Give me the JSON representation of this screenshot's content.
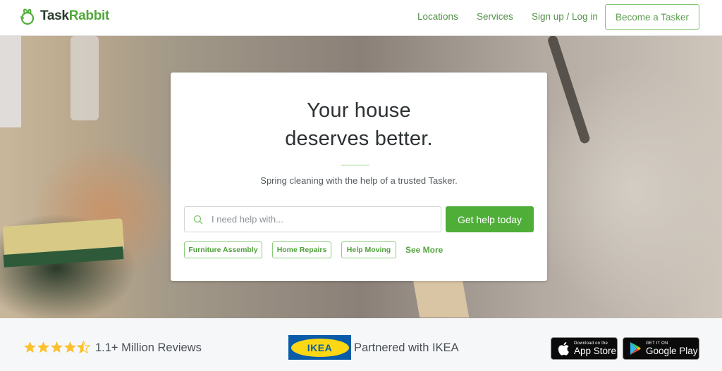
{
  "header": {
    "logo": {
      "part1": "Task",
      "part2": "Rabbit",
      "icon": "rabbit-logo-icon"
    },
    "nav": [
      {
        "label": "Locations"
      },
      {
        "label": "Services"
      },
      {
        "label": "Sign up / Log in"
      }
    ],
    "cta_label": "Become a Tasker"
  },
  "hero": {
    "headline_line1": "Your house",
    "headline_line2": "deserves better.",
    "subline": "Spring cleaning with the help of a trusted Tasker.",
    "search": {
      "placeholder": "I need help with...",
      "value": "",
      "icon": "search-icon"
    },
    "submit_label": "Get help today",
    "chips": [
      {
        "label": "Furniture Assembly"
      },
      {
        "label": "Home Repairs"
      },
      {
        "label": "Help Moving"
      }
    ],
    "see_more": "See More"
  },
  "footer": {
    "rating": {
      "value": 4.5,
      "max": 5
    },
    "reviews": "1.1+ Million Reviews",
    "ikea_logo": "IKEA",
    "partnered": "Partnered with IKEA",
    "app_store": {
      "small": "Download on the",
      "big": "App Store"
    },
    "google_play": {
      "small": "GET IT ON",
      "big": "Google Play"
    }
  },
  "colors": {
    "brand_green": "#4fae38",
    "nav_green": "#56924a",
    "star_yellow": "#fbc02d",
    "ikea_blue": "#0a5ca8",
    "ikea_yellow": "#fbd714"
  }
}
